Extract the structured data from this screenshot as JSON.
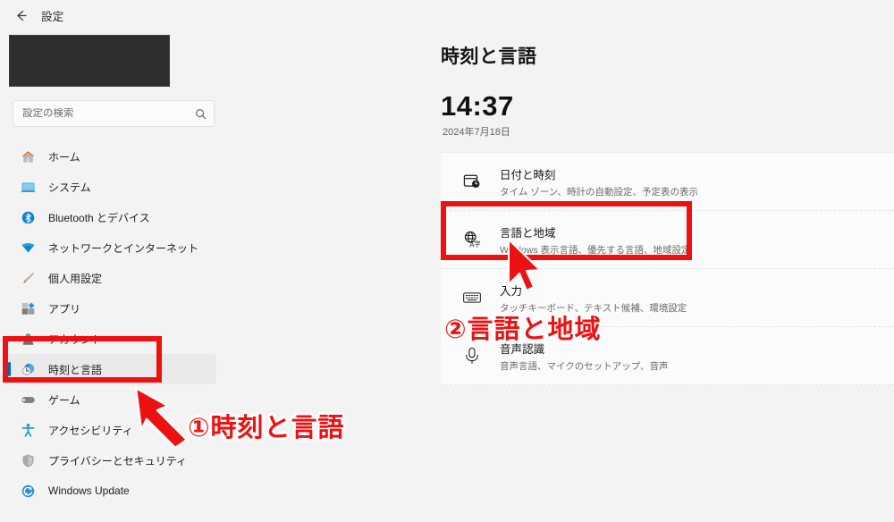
{
  "window": {
    "back_icon": "back-arrow-icon",
    "title": "設定"
  },
  "sidebar": {
    "profile_redacted": true,
    "search": {
      "placeholder": "設定の検索",
      "value": "",
      "icon": "search-icon"
    },
    "items": [
      {
        "label": "ホーム",
        "icon": "home-icon",
        "selected": false
      },
      {
        "label": "システム",
        "icon": "system-icon",
        "selected": false
      },
      {
        "label": "Bluetooth とデバイス",
        "icon": "bluetooth-icon",
        "selected": false
      },
      {
        "label": "ネットワークとインターネット",
        "icon": "network-icon",
        "selected": false
      },
      {
        "label": "個人用設定",
        "icon": "personalization-brush-icon",
        "selected": false
      },
      {
        "label": "アプリ",
        "icon": "apps-icon",
        "selected": false
      },
      {
        "label": "アカウント",
        "icon": "account-icon",
        "selected": false
      },
      {
        "label": "時刻と言語",
        "icon": "clock-globe-icon",
        "selected": true
      },
      {
        "label": "ゲーム",
        "icon": "gaming-controller-icon",
        "selected": false
      },
      {
        "label": "アクセシビリティ",
        "icon": "accessibility-icon",
        "selected": false
      },
      {
        "label": "プライバシーとセキュリティ",
        "icon": "shield-icon",
        "selected": false
      },
      {
        "label": "Windows Update",
        "icon": "update-icon",
        "selected": false
      }
    ]
  },
  "content": {
    "page_title": "時刻と言語",
    "clock_time": "14:37",
    "clock_date": "2024年7月18日",
    "cards": [
      {
        "title": "日付と時刻",
        "subtitle": "タイム ゾーン、時計の自動設定、予定表の表示",
        "icon": "calendar-clock-icon"
      },
      {
        "title": "言語と地域",
        "subtitle": "Windows 表示言語、優先する言語、地域設定",
        "icon": "language-globe-icon"
      },
      {
        "title": "入力",
        "subtitle": "タッチキーボード、テキスト候補、環境設定",
        "icon": "keyboard-icon"
      },
      {
        "title": "音声認識",
        "subtitle": "音声言語、マイクのセットアップ、音声",
        "icon": "speech-microphone-icon"
      }
    ]
  },
  "annotations": {
    "color": "#ee1111",
    "label_1": "①時刻と言語",
    "label_2": "②言語と地域",
    "arrow_1": "red-arrow-pointing-to-sidebar-item",
    "arrow_2": "red-cursor-pointing-to-language-card"
  }
}
